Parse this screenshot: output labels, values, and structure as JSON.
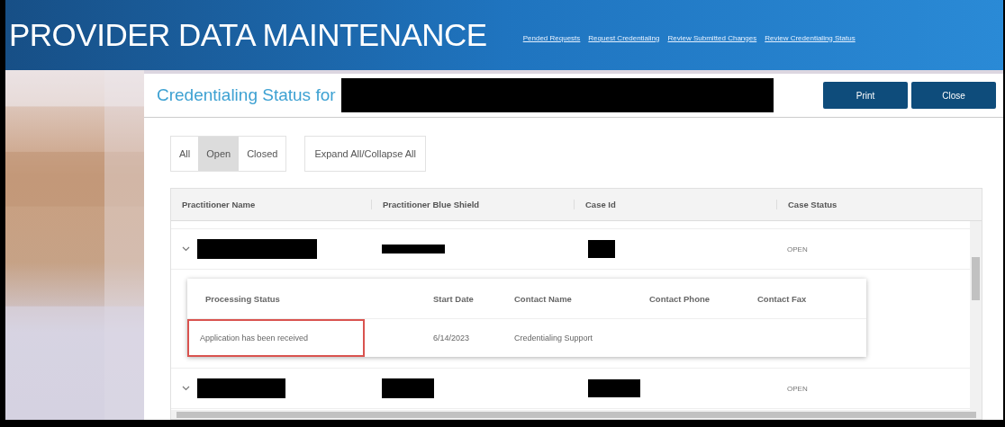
{
  "header": {
    "title": "PROVIDER DATA MAINTENANCE",
    "links": [
      "Pended Requests",
      "Request Credentialing",
      "Review Submitted Changes",
      "Review Credentialing Status"
    ]
  },
  "dialog": {
    "title": "Credentialing Status for",
    "buttons": [
      "Print",
      "Close"
    ],
    "filters": [
      {
        "label": "All",
        "selected": false
      },
      {
        "label": "Open",
        "selected": true
      },
      {
        "label": "Closed",
        "selected": false
      }
    ],
    "expand_toggle": "Expand All/Collapse All",
    "table": {
      "columns": [
        "Practitioner Name",
        "Practitioner Blue Shield",
        "Case Id",
        "Case Status"
      ],
      "rows": [
        {
          "case_status": "OPEN",
          "detail": {
            "columns": [
              "Processing Status",
              "Start Date",
              "Contact Name",
              "Contact Phone",
              "Contact Fax"
            ],
            "rows": [
              {
                "processing_status": "Application has been received",
                "start_date": "6/14/2023",
                "contact_name": "Credentialing Support",
                "highlighted": true
              }
            ]
          }
        },
        {
          "case_status": "OPEN"
        }
      ]
    }
  }
}
